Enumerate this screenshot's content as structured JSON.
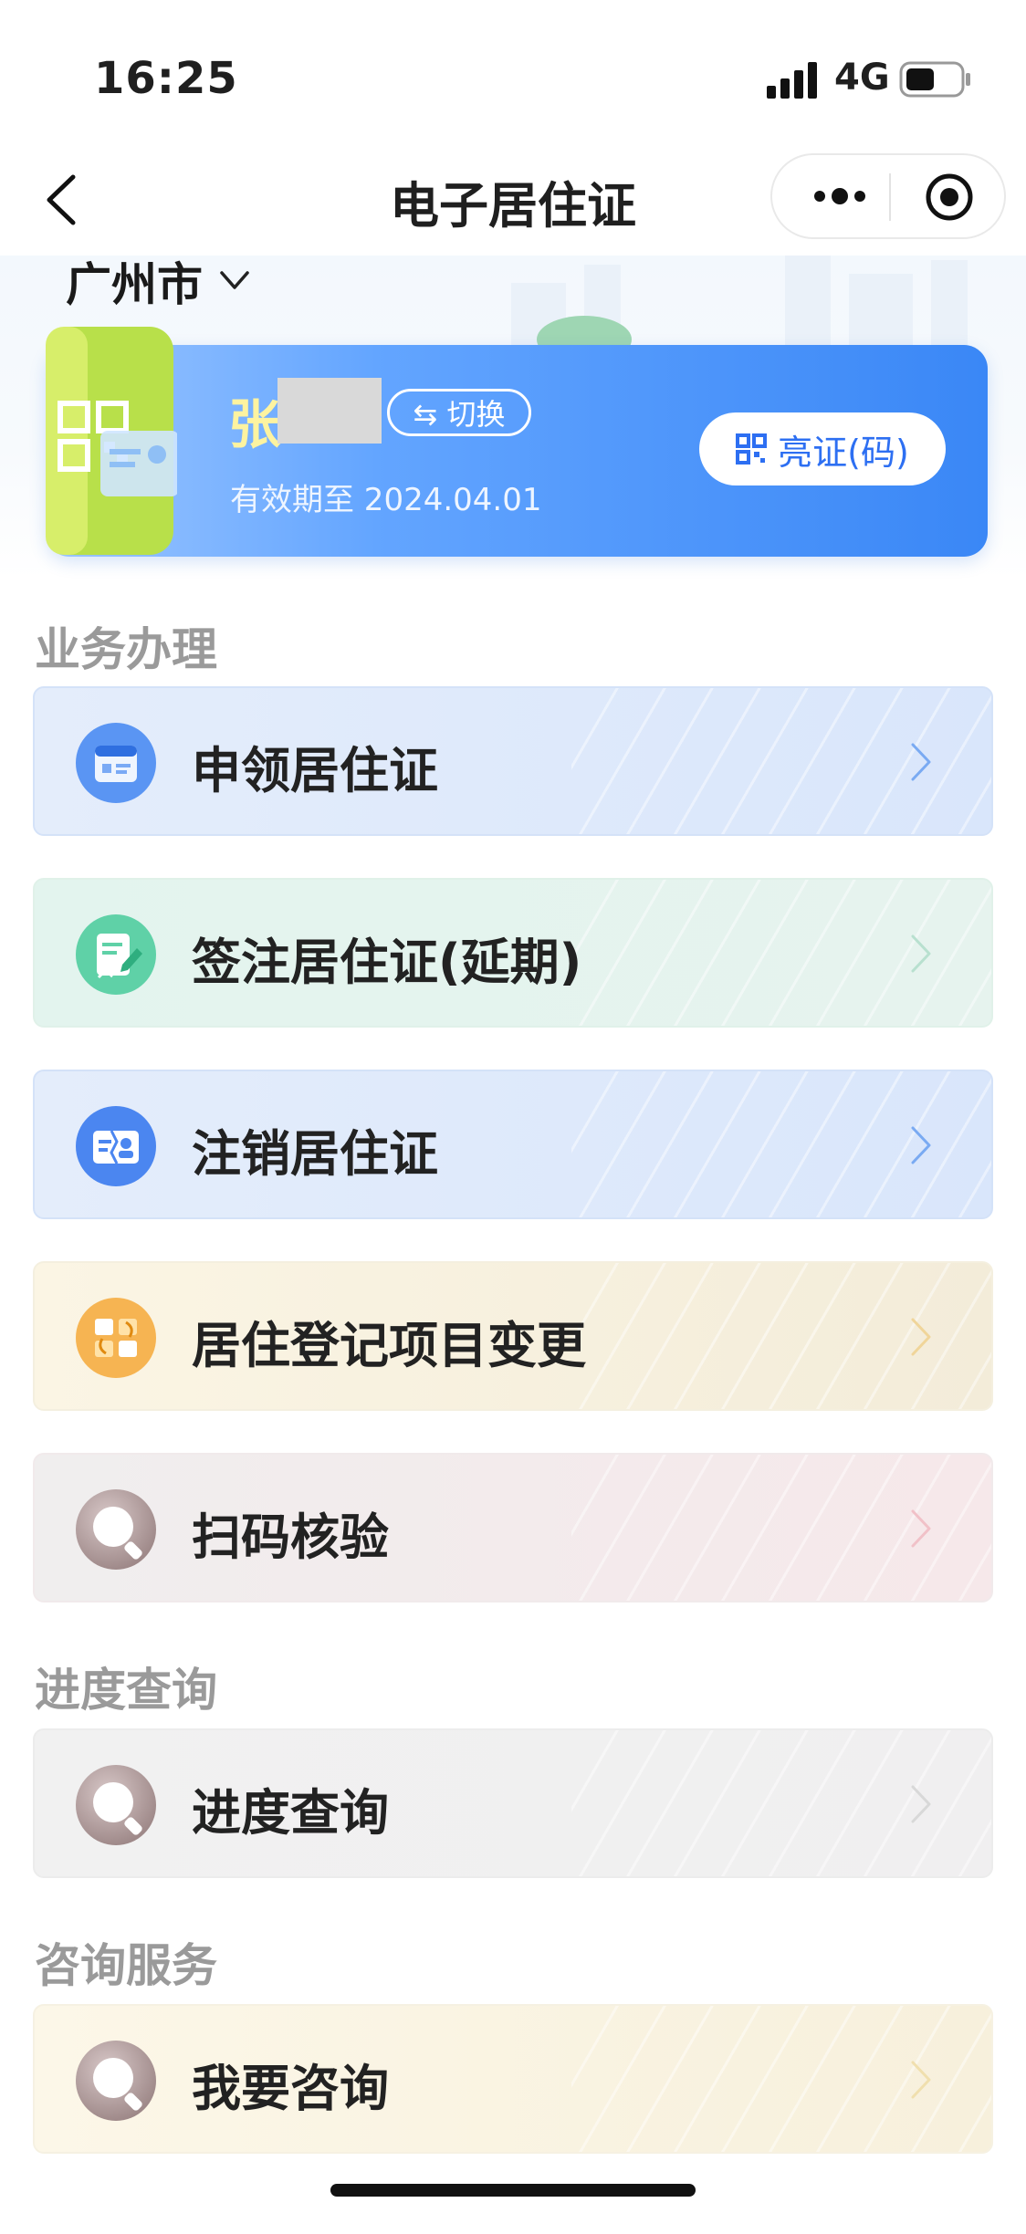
{
  "status_bar": {
    "time": "16:25",
    "network": "4G"
  },
  "nav": {
    "title": "电子居住证"
  },
  "city": {
    "name": "广州市"
  },
  "card": {
    "name_visible": "张",
    "switch_label": "⇆ 切换",
    "expiry": "有效期至 2024.04.01",
    "show_code_label": "亮证(码)"
  },
  "sections": {
    "business": "业务办理",
    "progress": "进度查询",
    "consult": "咨询服务"
  },
  "services": [
    {
      "label": "申领居住证",
      "icon": "id-card-icon",
      "theme": "blue",
      "accent": "#4a8bf2"
    },
    {
      "label": "签注居住证(延期)",
      "icon": "edit-document-icon",
      "theme": "green",
      "accent": "#46c79a"
    },
    {
      "label": "注销居住证",
      "icon": "cancel-card-icon",
      "theme": "blue",
      "accent": "#3f7df0"
    },
    {
      "label": "居住登记项目变更",
      "icon": "change-record-icon",
      "theme": "yellow",
      "accent": "#f3a43a"
    },
    {
      "label": "扫码核验",
      "icon": "search-icon",
      "theme": "pink",
      "accent": "#b49a9a"
    },
    {
      "label": "进度查询",
      "icon": "search-icon",
      "theme": "gray",
      "accent": "#b49a9a"
    },
    {
      "label": "我要咨询",
      "icon": "search-icon",
      "theme": "cream",
      "accent": "#b49a9a"
    }
  ]
}
